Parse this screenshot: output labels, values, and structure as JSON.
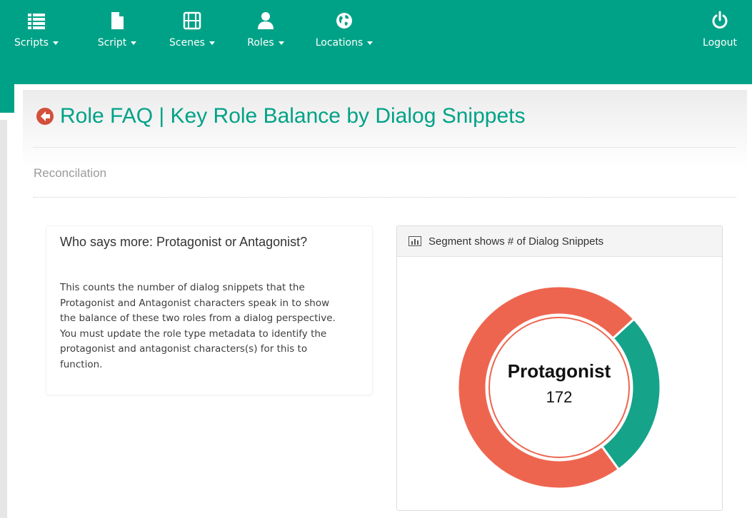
{
  "nav": {
    "items": [
      {
        "label": "Scripts",
        "icon": "list-icon"
      },
      {
        "label": "Script",
        "icon": "document-icon"
      },
      {
        "label": "Scenes",
        "icon": "film-icon"
      },
      {
        "label": "Roles",
        "icon": "user-icon"
      },
      {
        "label": "Locations",
        "icon": "globe-icon"
      }
    ],
    "logout": {
      "label": "Logout",
      "icon": "power-icon"
    }
  },
  "page": {
    "title": "Role FAQ | Key Role Balance by Dialog Snippets",
    "subtitle": "Reconcilation"
  },
  "info_panel": {
    "heading": "Who says more: Protagonist or Antagonist?",
    "body_lines": [
      "This counts the number of dialog snippets that the",
      "Protagonist and Antagonist characters speak in to show",
      "the balance of these two roles from a dialog perspective.",
      "You must update the role type metadata to identify the",
      "protagonist and antagonist characters(s) for this to",
      "function."
    ]
  },
  "chart_panel": {
    "header": "Segment shows # of Dialog Snippets",
    "center_label": "Protagonist",
    "center_value": "172"
  },
  "colors": {
    "brand": "#00a287",
    "protagonist": "#ee654f",
    "antagonist": "#15a38a"
  },
  "chart_data": {
    "type": "pie",
    "variant": "donut",
    "series": [
      {
        "name": "Protagonist",
        "value": 172,
        "color": "#ee654f"
      },
      {
        "value": 63,
        "color": "#15a38a"
      }
    ],
    "highlighted": "Protagonist"
  }
}
